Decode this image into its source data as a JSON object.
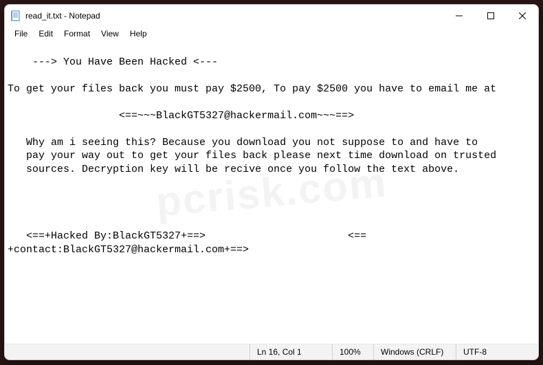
{
  "title": "read_it.txt - Notepad",
  "menu": {
    "file": "File",
    "edit": "Edit",
    "format": "Format",
    "view": "View",
    "help": "Help"
  },
  "content": "---> You Have Been Hacked <---\n\nTo get your files back you must pay $2500, To pay $2500 you have to email me at\n\n                  <==~~~BlackGT5327@hackermail.com~~~==>\n\n   Why am i seeing this? Because you download you not suppose to and have to\n   pay your way out to get your files back please next time download on trusted\n   sources. Decryption key will be recive once you follow the text above.\n\n\n\n\n   <==+Hacked By:BlackGT5327+==>                       <==\n+contact:BlackGT5327@hackermail.com+==>\n",
  "status": {
    "position": "Ln 16, Col 1",
    "zoom": "100%",
    "line_ending": "Windows (CRLF)",
    "encoding": "UTF-8"
  },
  "watermark": "pcrisk.com"
}
